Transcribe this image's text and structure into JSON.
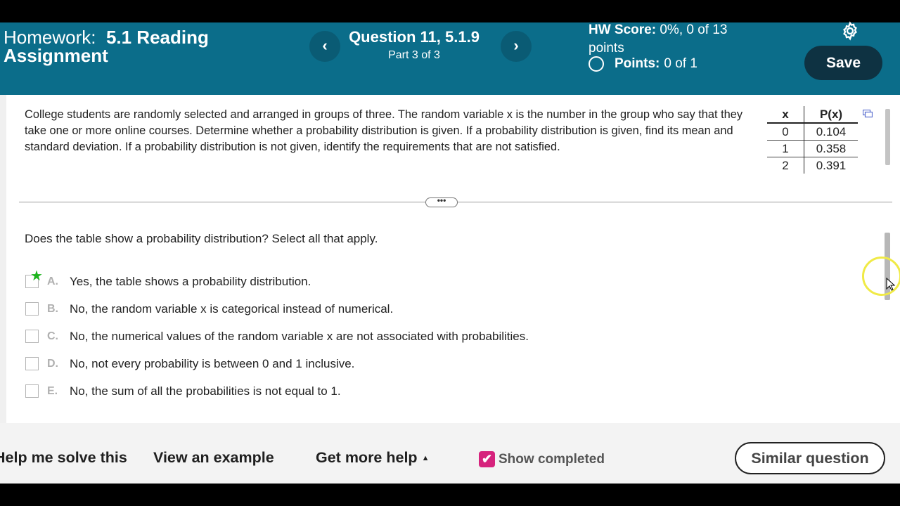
{
  "header": {
    "homework_label": "Homework:",
    "homework_name": "5.1 Reading Assignment",
    "question_title": "Question 11, 5.1.9",
    "question_part": "Part 3 of 3",
    "prev_glyph": "‹",
    "next_glyph": "›",
    "hw_score_label": "HW Score:",
    "hw_score_value": "0%, 0 of 13 points",
    "points_label": "Points:",
    "points_value": "0 of 1",
    "save_label": "Save",
    "settings_icon": "gear-icon",
    "color": "#0b6d8a"
  },
  "question": {
    "text": "College students are randomly selected and arranged in groups of three. The random variable x is the number in the group who say that they take one or more online courses. Determine whether a probability distribution is given. If a probability distribution is given, find its mean and standard deviation. If a probability distribution is not given, identify the requirements that are not satisfied.",
    "table": {
      "headers": [
        "x",
        "P(x)"
      ],
      "rows": [
        [
          "0",
          "0.104"
        ],
        [
          "1",
          "0.358"
        ],
        [
          "2",
          "0.391"
        ]
      ]
    }
  },
  "divider_handle": "•••",
  "prompt": "Does the table show a probability distribution? Select all that apply.",
  "options": [
    {
      "letter": "A.",
      "text": "Yes, the table shows a probability distribution.",
      "starred": true
    },
    {
      "letter": "B.",
      "text": "No, the random variable x is categorical instead of numerical.",
      "starred": false
    },
    {
      "letter": "C.",
      "text": "No, the numerical values of the random variable x are not associated with probabilities.",
      "starred": false
    },
    {
      "letter": "D.",
      "text": "No, not every probability is between 0 and 1 inclusive.",
      "starred": false
    },
    {
      "letter": "E.",
      "text": "No, the sum of all the probabilities is not equal to 1.",
      "starred": false
    }
  ],
  "footer": {
    "help_me_solve": "Help me solve this",
    "view_example": "View an example",
    "get_more_help": "Get more help",
    "show_completed": "Show completed",
    "show_completed_checked": true,
    "similar_question": "Similar question",
    "accent_color": "#d6237d"
  }
}
